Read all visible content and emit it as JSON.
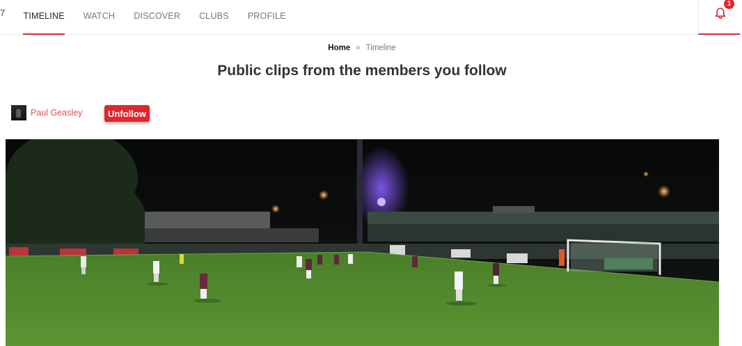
{
  "nav": {
    "left_mark": "7",
    "items": [
      {
        "label": "TIMELINE",
        "active": true
      },
      {
        "label": "WATCH",
        "active": false
      },
      {
        "label": "DISCOVER",
        "active": false
      },
      {
        "label": "CLUBS",
        "active": false
      },
      {
        "label": "PROFILE",
        "active": false
      }
    ],
    "notifications": {
      "count": "1",
      "icon": "bell-icon"
    }
  },
  "breadcrumb": {
    "home": "Home",
    "separator": "»",
    "current": "Timeline"
  },
  "page": {
    "title": "Public clips from the members you follow"
  },
  "post": {
    "member_name": "Paul Geasley",
    "unfollow_label": "Unfollow"
  },
  "colors": {
    "accent": "#e0262e",
    "member_link": "#d9534f",
    "pitch": "#4f8a2c"
  }
}
